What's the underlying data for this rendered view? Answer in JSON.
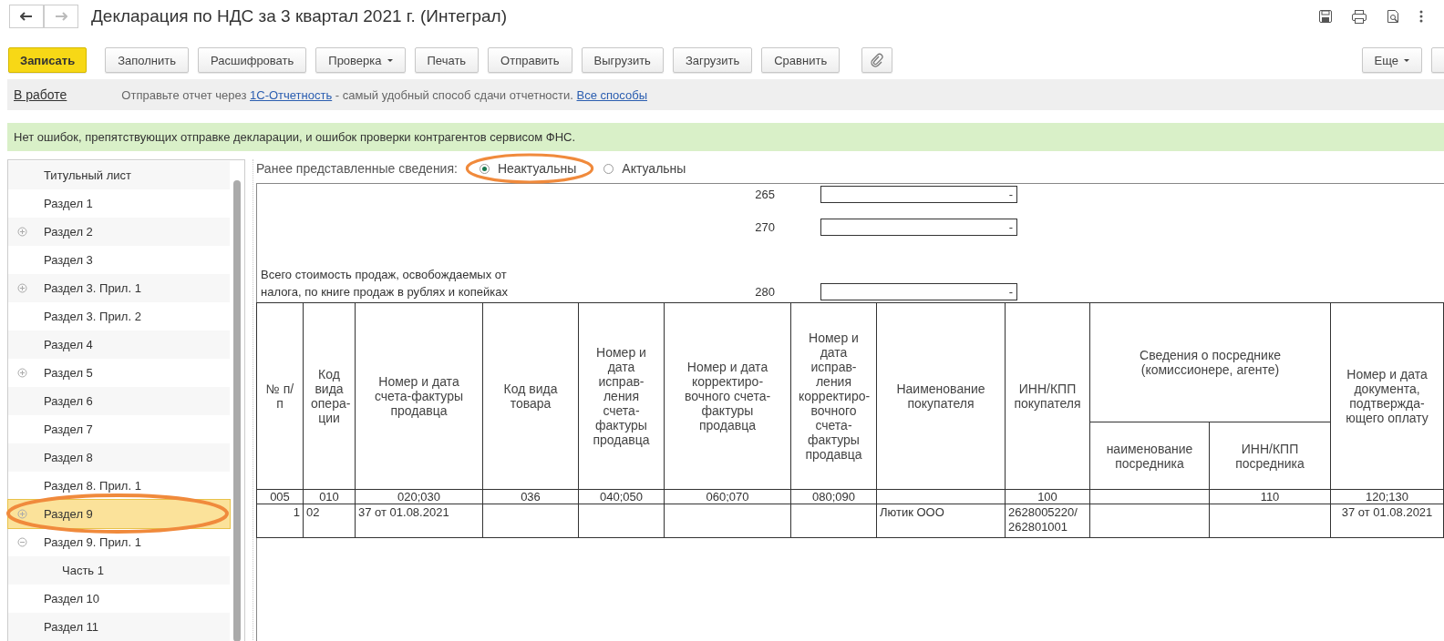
{
  "window": {
    "title": "Декларация по НДС за 3 квартал 2021 г. (Интеграл)"
  },
  "toolbar": {
    "buttons": [
      {
        "label": "Записать",
        "kind": "primary"
      },
      {
        "label": "Заполнить",
        "kind": "plain"
      },
      {
        "label": "Расшифровать",
        "kind": "plain"
      },
      {
        "label": "Проверка",
        "kind": "menu"
      },
      {
        "label": "Печать",
        "kind": "plain"
      },
      {
        "label": "Отправить",
        "kind": "plain"
      },
      {
        "label": "Выгрузить",
        "kind": "plain"
      },
      {
        "label": "Загрузить",
        "kind": "plain"
      },
      {
        "label": "Сравнить",
        "kind": "plain"
      },
      {
        "kind": "attach"
      }
    ],
    "more": {
      "label": "Еще"
    }
  },
  "info_bar": {
    "status": "В работе",
    "text": "Отправьте отчет через",
    "link": "1С-Отчетность",
    "text_after": "- самый удобный способ сдачи отчетности.",
    "link2": "Все способы"
  },
  "message": "Нет ошибок, препятствующих отправке декларации, и ошибок проверки контрагентов сервисом ФНС.",
  "sidebar": {
    "items": [
      {
        "label": "Титульный лист",
        "selected": false
      },
      {
        "label": "Раздел 1",
        "selected": false
      },
      {
        "label": "Раздел 2",
        "selected": false,
        "expanded": false
      },
      {
        "label": "Раздел 3",
        "selected": false
      },
      {
        "label": "Раздел 3. Прил. 1",
        "selected": false,
        "expanded": false
      },
      {
        "label": "Раздел 3. Прил. 2",
        "selected": false
      },
      {
        "label": "Раздел 4",
        "selected": false
      },
      {
        "label": "Раздел 5",
        "selected": false,
        "expanded": false
      },
      {
        "label": "Раздел 6",
        "selected": false
      },
      {
        "label": "Раздел 7",
        "selected": false
      },
      {
        "label": "Раздел 8",
        "selected": false
      },
      {
        "label": "Раздел 8. Прил. 1",
        "selected": false
      },
      {
        "label": "Раздел 9",
        "selected": true,
        "expanded": false
      },
      {
        "label": "Раздел 9. Прил. 1",
        "selected": false,
        "expanded": true,
        "children": [
          {
            "label": "Часть 1",
            "selected": false
          }
        ]
      },
      {
        "label": "Раздел 10",
        "selected": false
      },
      {
        "label": "Раздел 11",
        "selected": false
      }
    ]
  },
  "previous_info": {
    "label": "Ранее представленные сведения:",
    "options": [
      {
        "label": "Неактуальны",
        "selected": true
      },
      {
        "label": "Актуальны",
        "selected": false
      }
    ]
  },
  "form_lines": [
    {
      "code": "265",
      "value": "-"
    },
    {
      "code": "270",
      "value": "-"
    },
    {
      "label": "Всего стоимость продаж, освобождаемых от налога, по книге продаж в рублях и копейках",
      "code": "280",
      "value": "-"
    }
  ],
  "table": {
    "columns": [
      {
        "label": "№ п/п",
        "code": "005"
      },
      {
        "label": "Код вида опера-ции",
        "code": "010"
      },
      {
        "label": "Номер и дата счета-фактуры продавца",
        "code": "020;030"
      },
      {
        "label": "Код вида товара",
        "code": "036"
      },
      {
        "label": "Номер и дата исправ-ления счета-фактуры продавца",
        "code": "040;050"
      },
      {
        "label": "Номер и дата корректиро-вочного счета-фактуры продавца",
        "code": "060;070"
      },
      {
        "label": "Номер и дата исправ-ления корректиро-вочного счета-фактуры продавца",
        "code": "080;090"
      },
      {
        "label": "Наименование покупателя"
      },
      {
        "label": "ИНН/КПП покупателя",
        "code": "100"
      },
      {
        "label": "Сведения о посреднике (комиссионере, агенте)",
        "children": [
          {
            "label": "наименование посредника"
          },
          {
            "label": "ИНН/КПП посредника",
            "code": "110"
          }
        ]
      },
      {
        "label": "Номер и дата документа, подтвержда-ющего оплату",
        "code": "120;130"
      }
    ],
    "rows": [
      {
        "cells": [
          "1",
          "02",
          "37 от 01.08.2021",
          "",
          "",
          "",
          "",
          "Лютик ООО",
          "2628005220/ 262801001",
          "",
          "",
          "37 от 01.08.2021"
        ]
      }
    ]
  }
}
